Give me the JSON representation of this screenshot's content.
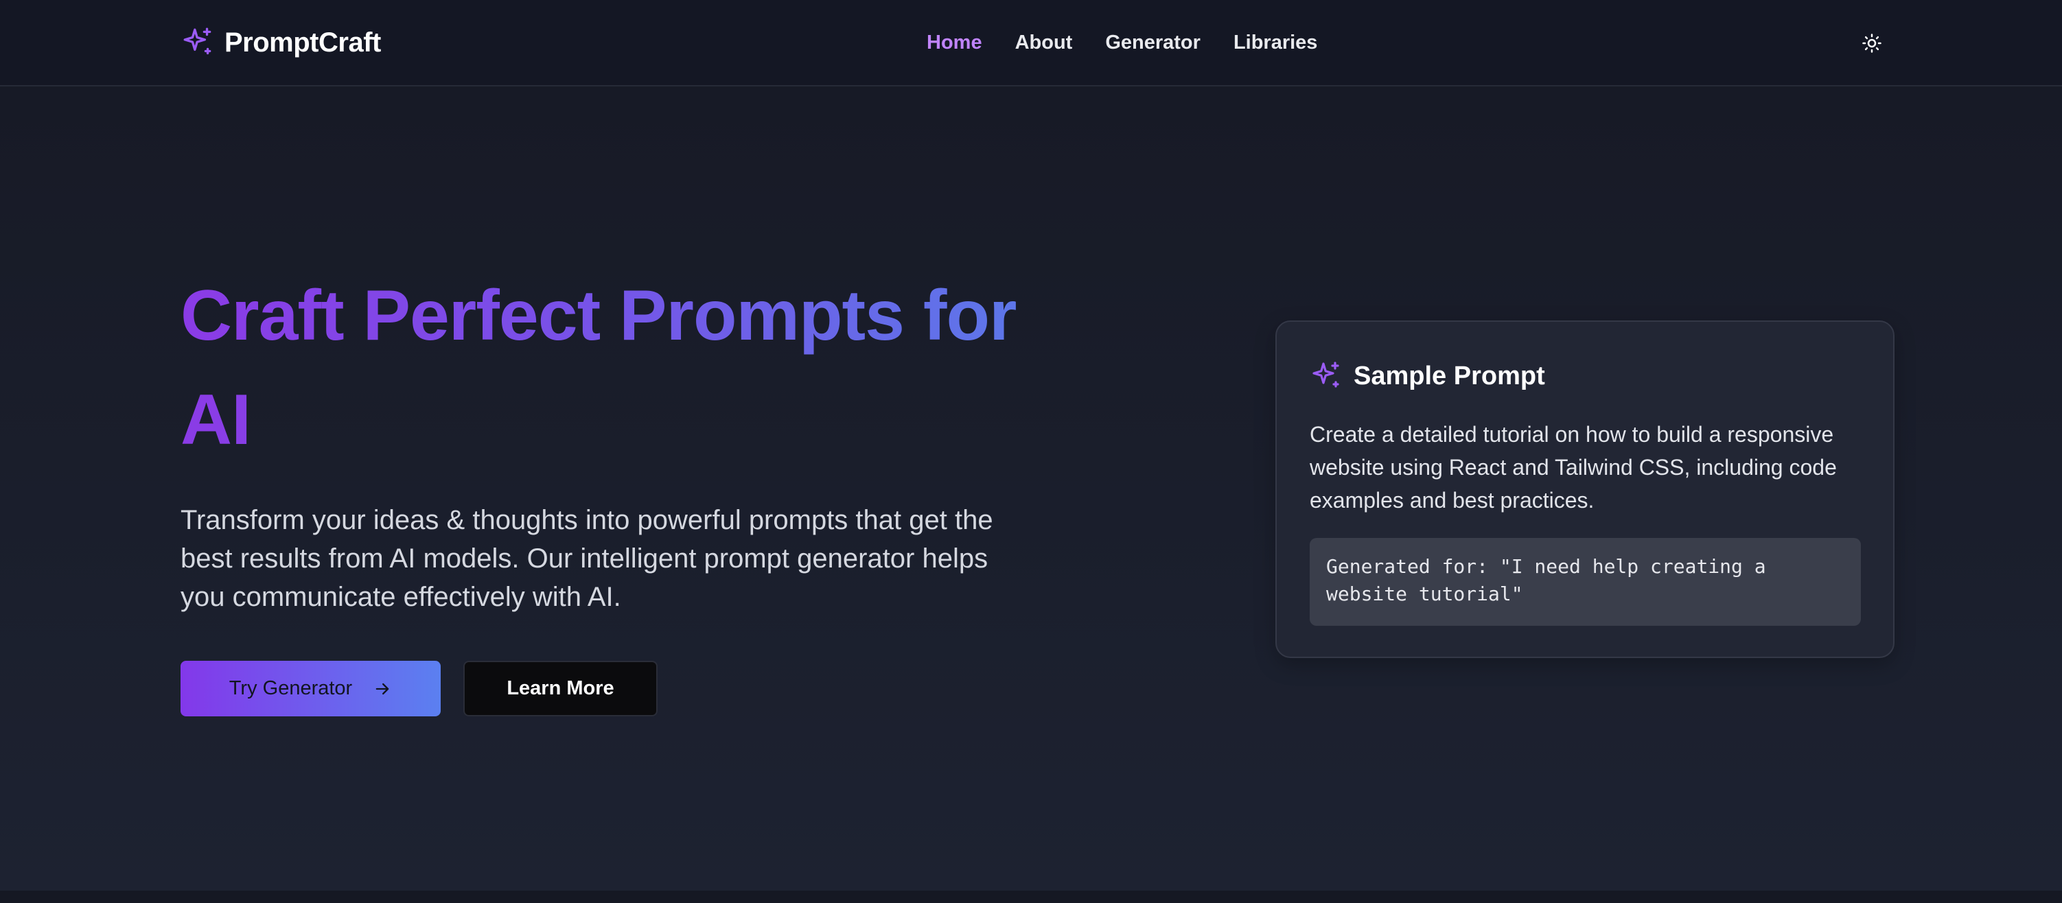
{
  "header": {
    "brand_name": "PromptCraft",
    "brand_icon": "sparkles-icon",
    "nav": [
      {
        "label": "Home",
        "active": true
      },
      {
        "label": "About",
        "active": false
      },
      {
        "label": "Generator",
        "active": false
      },
      {
        "label": "Libraries",
        "active": false
      }
    ],
    "theme_toggle_icon": "sun-icon"
  },
  "hero": {
    "headline": "Craft Perfect Prompts for AI",
    "subtext": "Transform your ideas & thoughts into powerful prompts that get the best results from AI models. Our intelligent prompt generator helps you communicate effectively with AI.",
    "primary_button": {
      "label": "Try Generator",
      "icon": "arrow-right-icon"
    },
    "secondary_button": {
      "label": "Learn More"
    }
  },
  "sample_card": {
    "icon": "sparkles-icon",
    "title": "Sample Prompt",
    "body": "Create a detailed tutorial on how to build a responsive website using React and Tailwind CSS, including code examples and best practices.",
    "generated_for": "Generated for: \"I need help creating a website tutorial\""
  },
  "colors": {
    "accent_purple": "#8b3be6",
    "accent_blue": "#5a7be9",
    "active_nav": "#c084fc",
    "background": "#1b1f2b",
    "header_background": "#141724",
    "card_background": "#222634"
  }
}
